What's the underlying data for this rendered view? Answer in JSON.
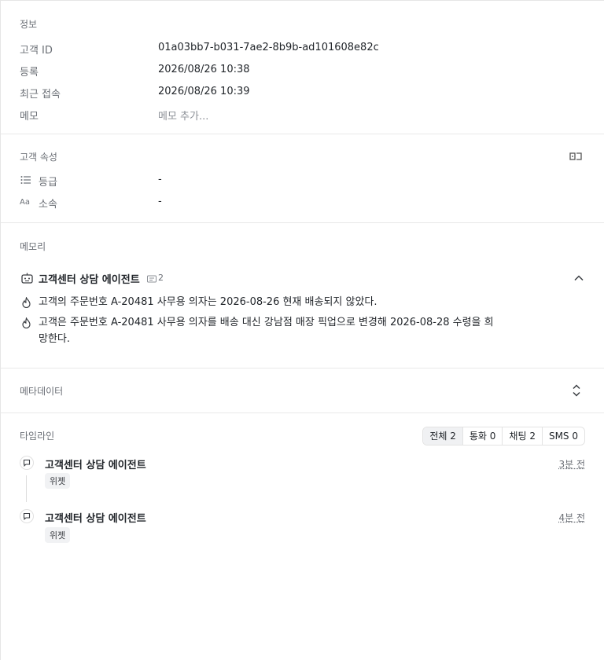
{
  "info": {
    "title": "정보",
    "rows": [
      {
        "label": "고객 ID",
        "value": "01a03bb7-b031-7ae2-8b9b-ad101608e82c"
      },
      {
        "label": "등록",
        "value": "2026/08/26 10:38"
      },
      {
        "label": "최근 접속",
        "value": "2026/08/26 10:39"
      },
      {
        "label": "메모",
        "value": "메모 추가..."
      }
    ]
  },
  "attributes": {
    "title": "고객 속성",
    "rows": [
      {
        "icon": "list-icon",
        "label": "등급",
        "value": "-"
      },
      {
        "icon": "text-type-icon",
        "label": "소속",
        "value": "-"
      }
    ]
  },
  "memory": {
    "title": "메모리",
    "agent_name": "고객센터 상담 에이전트",
    "agent_count": "2",
    "items": [
      "고객의 주문번호 A-20481 사무용 의자는 2026-08-26 현재 배송되지 않았다.",
      "고객은 주문번호 A-20481 사무용 의자를 배송 대신 강남점 매장 픽업으로 변경해 2026-08-28 수령을 희망한다."
    ]
  },
  "metadata": {
    "title": "메타데이터"
  },
  "timeline": {
    "title": "타임라인",
    "tabs": [
      "전체 2",
      "통화 0",
      "채팅 2",
      "SMS 0"
    ],
    "entries": [
      {
        "title": "고객센터 상담 에이전트",
        "chip": "위젯",
        "time": "3분 전"
      },
      {
        "title": "고객센터 상담 에이전트",
        "chip": "위젯",
        "time": "4분 전"
      }
    ]
  },
  "colors": {
    "border": "#e8e8e8",
    "muted_text": "#6b6f76",
    "primary_text": "#1f2328"
  }
}
